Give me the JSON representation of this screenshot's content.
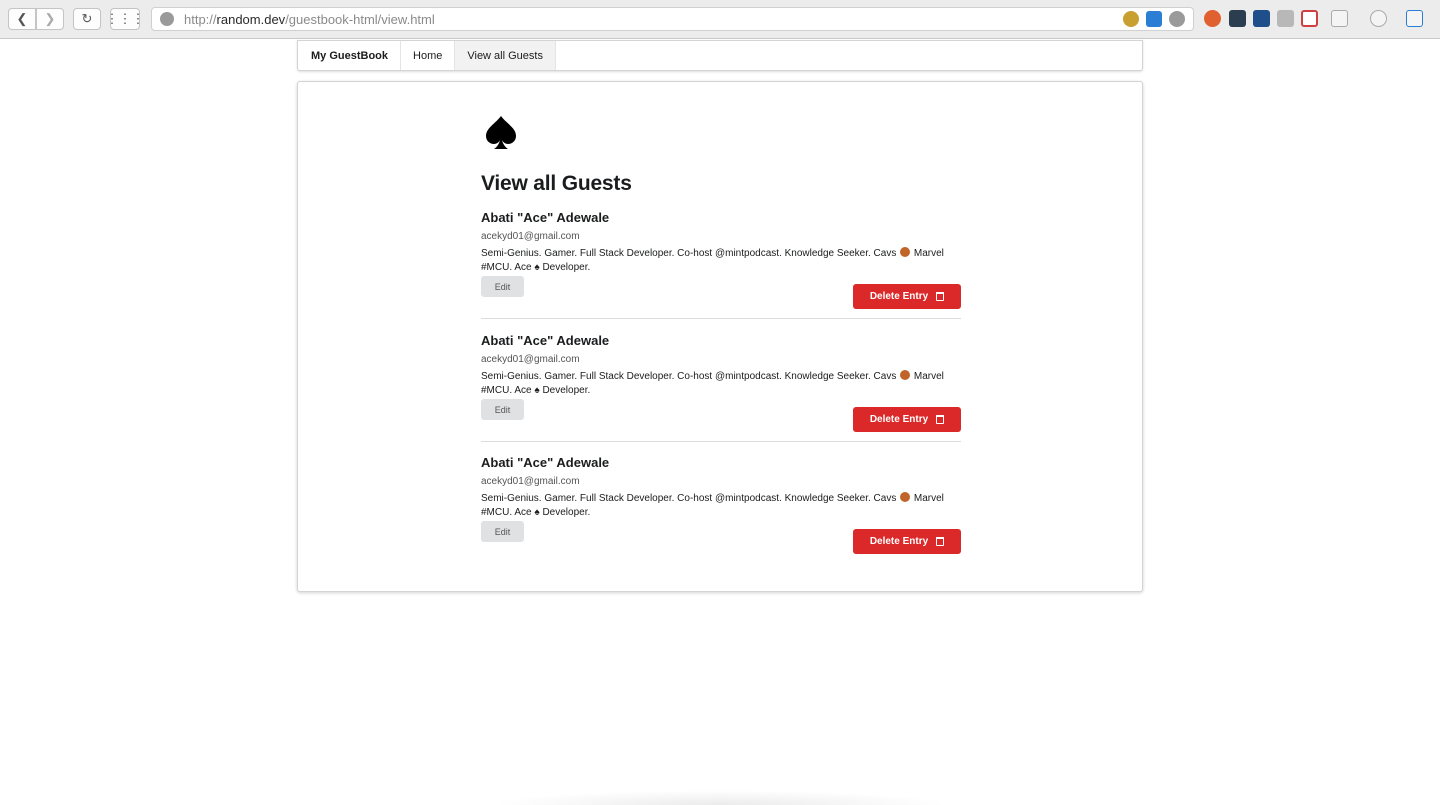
{
  "browser": {
    "url_scheme": "http://",
    "url_host": "random.dev",
    "url_path": "/guestbook-html/view.html"
  },
  "menu": {
    "brand": "My GuestBook",
    "items": [
      {
        "label": "Home"
      },
      {
        "label": "View all Guests"
      }
    ]
  },
  "page": {
    "title": "View all Guests"
  },
  "entries": [
    {
      "name": "Abati \"Ace\" Adewale",
      "email": "acekyd01@gmail.com",
      "bio_part1": "Semi-Genius. Gamer. Full Stack Developer. Co-host @mintpodcast. Knowledge Seeker. Cavs",
      "bio_part2": " Marvel #MCU. Ace ♠ Developer.",
      "edit_label": "Edit",
      "delete_label": "Delete Entry"
    },
    {
      "name": "Abati \"Ace\" Adewale",
      "email": "acekyd01@gmail.com",
      "bio_part1": "Semi-Genius. Gamer. Full Stack Developer. Co-host @mintpodcast. Knowledge Seeker. Cavs",
      "bio_part2": " Marvel #MCU. Ace ♠ Developer.",
      "edit_label": "Edit",
      "delete_label": "Delete Entry"
    },
    {
      "name": "Abati \"Ace\" Adewale",
      "email": "acekyd01@gmail.com",
      "bio_part1": "Semi-Genius. Gamer. Full Stack Developer. Co-host @mintpodcast. Knowledge Seeker. Cavs",
      "bio_part2": " Marvel #MCU. Ace ♠ Developer.",
      "edit_label": "Edit",
      "delete_label": "Delete Entry"
    }
  ],
  "colors": {
    "delete_button": "#db2828",
    "edit_button": "#e0e1e2"
  }
}
